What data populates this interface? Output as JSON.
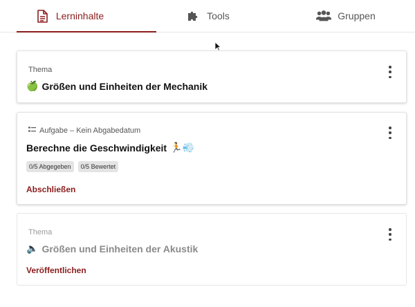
{
  "tabs": [
    {
      "label": "Lerninhalte",
      "icon": "document-icon",
      "active": true
    },
    {
      "label": "Tools",
      "icon": "puzzle-icon",
      "active": false
    },
    {
      "label": "Gruppen",
      "icon": "users-icon",
      "active": false
    }
  ],
  "cards": [
    {
      "meta": "Thema",
      "title": "Größen und Einheiten der Mechanik",
      "emoji": "🍏"
    },
    {
      "meta": "Aufgabe – Kein Abgabedatum",
      "title": "Berechne die Geschwindigkeit",
      "emoji": "🏃💨",
      "chips": [
        "0/5 Abgegeben",
        "0/5 Bewertet"
      ],
      "action": "Abschließen"
    },
    {
      "meta": "Thema",
      "title": "Größen und Einheiten der Akustik",
      "emoji": "🔈",
      "action": "Veröffentlichen"
    }
  ],
  "colors": {
    "accent": "#8b1d1d",
    "border": "#e3e3e3",
    "chip": "#e4e4e4"
  }
}
